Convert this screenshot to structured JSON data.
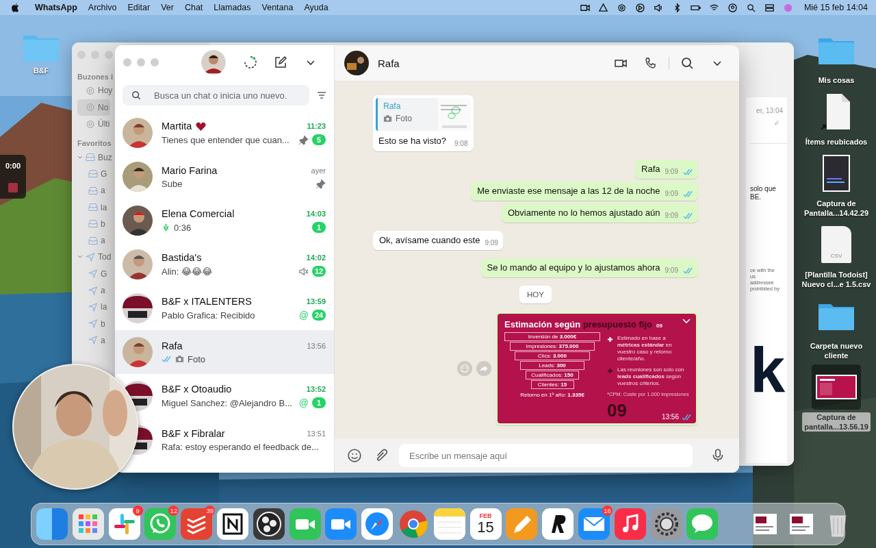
{
  "menubar": {
    "app": "WhatsApp",
    "menus": [
      "Archivo",
      "Editar",
      "Ver",
      "Chat",
      "Llamadas",
      "Ventana",
      "Ayuda"
    ],
    "clock": "Mié 15 feb 14:04"
  },
  "desktop": {
    "left_icons": [
      {
        "label": "B&F",
        "kind": "folder",
        "selected": false
      }
    ],
    "right_icons": [
      {
        "label": "Mis cosas",
        "kind": "folder",
        "selected": false
      },
      {
        "label": "Ítems reubicados",
        "kind": "alias",
        "selected": false
      },
      {
        "label": "Captura de\nPantalla...14.42.29",
        "kind": "dark-shot",
        "selected": false
      },
      {
        "label": "[Plantilla Todoist]\nNuevo cl...e 1.5.csv",
        "kind": "csv",
        "file_type": "CSV",
        "selected": false
      },
      {
        "label": "Carpeta nuevo\ncliente",
        "kind": "folder",
        "selected": false
      },
      {
        "label": "Captura de\npantalla...13.56.19",
        "kind": "red-shot",
        "selected": true
      }
    ]
  },
  "recorder": {
    "time": "0:00"
  },
  "mail_window": {
    "sidebar": [
      {
        "kind": "section",
        "label": "Buzones i"
      },
      {
        "kind": "item",
        "label": "Hoy",
        "selected": false
      },
      {
        "kind": "item",
        "label": "No",
        "selected": true
      },
      {
        "kind": "item",
        "label": "Últi",
        "selected": false
      },
      {
        "kind": "section",
        "label": "Favoritos"
      },
      {
        "kind": "group",
        "label": "Buz",
        "selected": false
      },
      {
        "kind": "inbox",
        "label": "G",
        "selected": false
      },
      {
        "kind": "inbox",
        "label": "a",
        "selected": false
      },
      {
        "kind": "inbox",
        "label": "la",
        "selected": false
      },
      {
        "kind": "inbox",
        "label": "b",
        "selected": false
      },
      {
        "kind": "inbox",
        "label": "a",
        "selected": false
      },
      {
        "kind": "sent-group",
        "label": "Tod",
        "selected": false
      },
      {
        "kind": "sent",
        "label": "G",
        "selected": false
      },
      {
        "kind": "sent",
        "label": "a",
        "selected": false
      },
      {
        "kind": "sent",
        "label": "la",
        "selected": false
      },
      {
        "kind": "sent",
        "label": "b",
        "selected": false
      },
      {
        "kind": "sent",
        "label": "a",
        "selected": false
      }
    ],
    "message": {
      "date": "er, 13:04",
      "body_lines": [
        "solo que",
        "BE."
      ],
      "disclaimer_lines": [
        "ce with the",
        "us",
        "addressee",
        "prohibited by"
      ],
      "big_letter": "k"
    }
  },
  "whatsapp": {
    "search_placeholder": "Busca un chat o inicia uno nuevo.",
    "chats": [
      {
        "name": "Martita",
        "group": false,
        "heart": true,
        "kind": "text",
        "preview": "Tienes que entender que cuan...",
        "time": "11:23",
        "unread": "5",
        "pinned": true,
        "muted": false,
        "selected": false
      },
      {
        "name": "Mario Farina",
        "group": false,
        "heart": false,
        "kind": "text",
        "preview": "Sube",
        "time": "ayer",
        "pinned": true,
        "muted": false,
        "selected": false
      },
      {
        "name": "Elena Comercial",
        "group": false,
        "heart": false,
        "kind": "voice",
        "preview": "0:36",
        "time": "14:03",
        "unread": "1",
        "pinned": false,
        "muted": false,
        "selected": false
      },
      {
        "name": "Bastida's",
        "group": false,
        "heart": false,
        "kind": "text",
        "preview": "Alin: 😂😂😂",
        "time": "14:02",
        "unread": "12",
        "pinned": false,
        "muted": true,
        "selected": false
      },
      {
        "name": "B&F x ITALENTERS",
        "group": true,
        "heart": false,
        "kind": "text",
        "preview": "Pablo Grafica: Recibido",
        "time": "13:59",
        "mention": "@",
        "unread": "24",
        "pinned": false,
        "muted": false,
        "selected": false
      },
      {
        "name": "Rafa",
        "group": false,
        "heart": false,
        "preview": "Foto",
        "read": true,
        "time": "13:56",
        "pinned": false,
        "muted": false,
        "selected": true
      },
      {
        "name": "B&F x Otoaudio",
        "group": true,
        "heart": false,
        "kind": "text",
        "preview": "Miguel Sanchez: @Alejandro B...",
        "time": "13:52",
        "mention": "@",
        "unread": "1",
        "pinned": false,
        "muted": false,
        "selected": false
      },
      {
        "name": "B&F x Fibralar",
        "group": true,
        "heart": false,
        "kind": "text",
        "preview": "Rafa: estoy esperando el feedback de...",
        "time": "13:51",
        "pinned": false,
        "muted": false,
        "selected": false
      }
    ],
    "contact": "Rafa",
    "messages": [
      {
        "kind": "quote",
        "quote_author": "Rafa",
        "quote_text": "Foto",
        "text": "Esto se ha visto?",
        "time": "9:08"
      },
      {
        "kind": "out",
        "text": "Rafa",
        "time": "9:09",
        "read": true
      },
      {
        "kind": "out",
        "text": "Me enviaste ese mensaje a las 12 de la noche",
        "time": "9:09",
        "read": true
      },
      {
        "kind": "out",
        "text": "Obviamente no lo hemos ajustado aún",
        "time": "9:09",
        "read": true
      },
      {
        "kind": "in",
        "text": "Ok, avísame cuando este",
        "time": "9:09"
      },
      {
        "kind": "out",
        "text": "Se lo mando al equipo y lo ajustamos ahora",
        "time": "9:09",
        "read": true
      },
      {
        "kind": "date",
        "text": "HOY"
      },
      {
        "kind": "slide",
        "time": "13:56",
        "read": true,
        "slide": {
          "title": "Estimación según",
          "title_accent": "presupuesto fijo",
          "page": "09",
          "big_page": "09",
          "funnel": [
            "Inversión de **3.000€**",
            "Impresiones: **375.000**",
            "Clics: **3.000**",
            "Leads: **300**",
            "Cualificados: **150**",
            "Clientes: **15**"
          ],
          "result": "Retorno en 1º año: **1.335€**",
          "bullets": [
            "Estimado en base a **métricas estándar** en vuestro caso y retorno cliente/año.",
            "Las reuniones son solo con **leads cualificados** según vuestros criterios."
          ],
          "note": "*CPM: Coste por 1.000 impresiones"
        }
      }
    ],
    "composer_placeholder": "Escribe un mensaje aquí"
  },
  "dock": {
    "apps": [
      {
        "kind": "finder"
      },
      {
        "kind": "launchpad"
      },
      {
        "kind": "slack",
        "badge": "9"
      },
      {
        "kind": "whatsapp",
        "badge": "12"
      },
      {
        "kind": "todoist",
        "badge": "39"
      },
      {
        "kind": "notion"
      },
      {
        "kind": "obs"
      },
      {
        "kind": "facetime"
      },
      {
        "kind": "zoom"
      },
      {
        "kind": "safari"
      },
      {
        "kind": "chrome"
      },
      {
        "kind": "notes"
      },
      {
        "kind": "calendar",
        "month": "FEB",
        "day": "15"
      },
      {
        "kind": "pencil"
      },
      {
        "kind": "r"
      },
      {
        "kind": "mail",
        "badge": "16"
      },
      {
        "kind": "music"
      },
      {
        "kind": "settings"
      },
      {
        "kind": "messages"
      }
    ],
    "stack": [
      {
        "kind": "doc"
      },
      {
        "kind": "doc"
      },
      {
        "kind": "trash"
      }
    ]
  }
}
